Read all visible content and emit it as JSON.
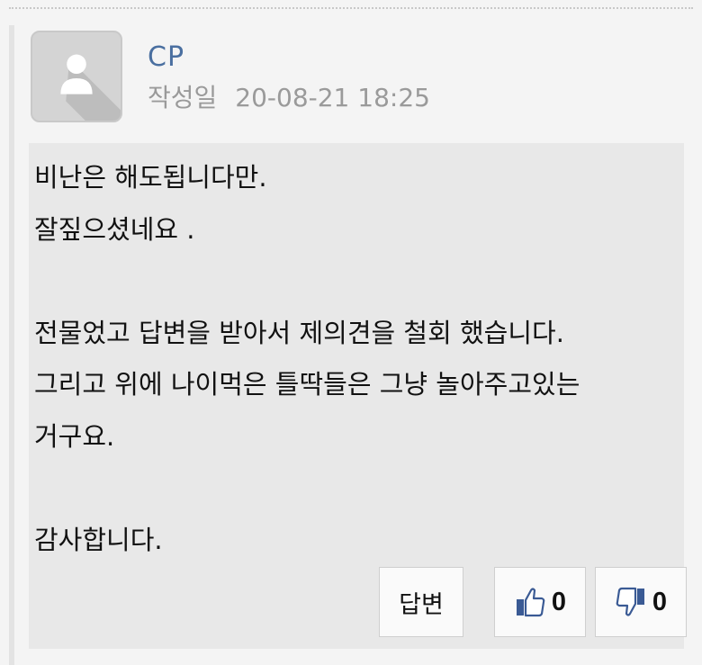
{
  "comment": {
    "author": "CP",
    "date_label": "작성일",
    "date": "20-08-21 18:25",
    "avatar_icon": "default-user-icon",
    "body_lines": [
      "비난은 해도됩니다만.",
      "잘짚으셨네요 .",
      "",
      "전물었고 답변을 받아서 제의견을 철회 했습니다.",
      "그리고 위에 나이먹은 틀딱들은 그냥 놀아주고있는",
      "거구요.",
      "",
      "감사합니다."
    ]
  },
  "actions": {
    "reply_label": "답변",
    "like_icon": "thumbs-up-icon",
    "like_count": "0",
    "dislike_icon": "thumbs-down-icon",
    "dislike_count": "0"
  },
  "colors": {
    "author": "#4a6fa0",
    "meta": "#9a9a9a",
    "body_bg": "#e8e8e8",
    "thumb_blue": "#3a5a94"
  }
}
